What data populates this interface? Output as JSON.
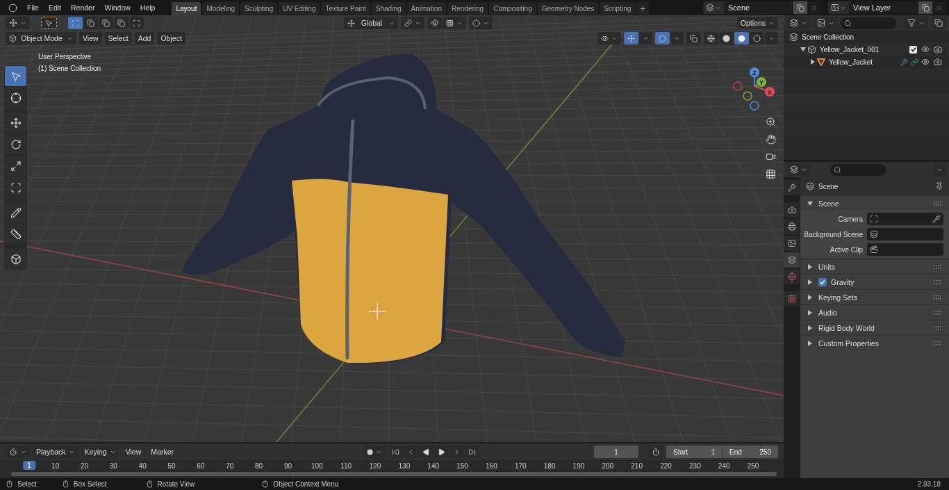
{
  "menu": [
    "File",
    "Edit",
    "Render",
    "Window",
    "Help"
  ],
  "workspace_tabs": [
    {
      "label": "Layout",
      "selected": true
    },
    {
      "label": "Modeling",
      "selected": false
    },
    {
      "label": "Sculpting",
      "selected": false
    },
    {
      "label": "UV Editing",
      "selected": false
    },
    {
      "label": "Texture Paint",
      "selected": false
    },
    {
      "label": "Shading",
      "selected": false
    },
    {
      "label": "Animation",
      "selected": false
    },
    {
      "label": "Rendering",
      "selected": false
    },
    {
      "label": "Compositing",
      "selected": false
    },
    {
      "label": "Geometry Nodes",
      "selected": false
    },
    {
      "label": "Scripting",
      "selected": false
    }
  ],
  "add_tab": "+",
  "scene": "Scene",
  "view_layer": "View Layer",
  "viewport": {
    "select_modes": [
      {
        "selected": true
      },
      {
        "selected": false
      },
      {
        "selected": false
      },
      {
        "selected": false
      },
      {
        "selected": false
      }
    ],
    "gizmos_on": true,
    "overlays_on": true,
    "orientation": "Global",
    "options": "Options",
    "mode": "Object Mode",
    "menus": [
      "View",
      "Select",
      "Add",
      "Object"
    ],
    "overlay_text": [
      "User Perspective",
      "(1) Scene Collection"
    ],
    "tools": [
      {
        "kind": "select",
        "selected": true
      },
      {
        "kind": "cursor",
        "selected": false
      },
      {
        "kind": "move",
        "selected": false
      },
      {
        "kind": "rotate",
        "selected": false
      },
      {
        "kind": "scale",
        "selected": false
      },
      {
        "kind": "transform",
        "selected": false
      },
      {
        "kind": "annotate",
        "selected": false
      },
      {
        "kind": "measure",
        "selected": false
      },
      {
        "kind": "add-cube",
        "selected": false
      }
    ],
    "shading": [
      {
        "kind": "wireframe",
        "selected": false
      },
      {
        "kind": "solid",
        "selected": false
      },
      {
        "kind": "material",
        "selected": true
      },
      {
        "kind": "rendered",
        "selected": false
      }
    ],
    "axes": [
      "Z",
      "Y",
      "X"
    ]
  },
  "outliner": {
    "items": [
      {
        "label": "Scene Collection",
        "kind": "root",
        "children": [
          {
            "label": "Yellow_Jacket_001",
            "kind": "collection",
            "expanded": true,
            "checked": true,
            "children": [
              {
                "label": "Yellow_Jacket",
                "kind": "mesh",
                "expanded": false
              }
            ]
          }
        ]
      }
    ]
  },
  "properties": {
    "tabs": [
      {
        "kind": "tool",
        "selected": false
      },
      {
        "kind": "render",
        "selected": false
      },
      {
        "kind": "output",
        "selected": false
      },
      {
        "kind": "view-layer",
        "selected": false
      },
      {
        "kind": "scene",
        "selected": true
      },
      {
        "kind": "world",
        "selected": false
      },
      {
        "kind": "texture",
        "selected": false
      }
    ],
    "context": "Scene",
    "panel": {
      "title": "Scene",
      "expanded": true,
      "fields": [
        {
          "label": "Camera",
          "kind": "camera"
        },
        {
          "label": "Background Scene",
          "kind": "scene"
        },
        {
          "label": "Active Clip",
          "kind": "clip"
        }
      ]
    },
    "sections": [
      {
        "label": "Units",
        "kind": "plain"
      },
      {
        "label": "Gravity",
        "kind": "checkbox",
        "checked": true
      },
      {
        "label": "Keying Sets",
        "kind": "plain"
      },
      {
        "label": "Audio",
        "kind": "plain"
      },
      {
        "label": "Rigid Body World",
        "kind": "plain"
      },
      {
        "label": "Custom Properties",
        "kind": "plain"
      }
    ]
  },
  "timeline": {
    "menus": [
      "Playback",
      "Keying",
      "View",
      "Marker"
    ],
    "current_frame": "1",
    "start_label": "Start",
    "start": "1",
    "end_label": "End",
    "end": "250",
    "marker": "1",
    "ticks": [
      "10",
      "20",
      "30",
      "40",
      "50",
      "60",
      "70",
      "80",
      "90",
      "100",
      "110",
      "120",
      "130",
      "140",
      "150",
      "160",
      "170",
      "180",
      "190",
      "200",
      "210",
      "220",
      "230",
      "240",
      "250"
    ]
  },
  "status_bar": {
    "hints": [
      "Select",
      "Box Select",
      "Rotate View",
      "Object Context Menu"
    ],
    "version": "2.93.18"
  }
}
